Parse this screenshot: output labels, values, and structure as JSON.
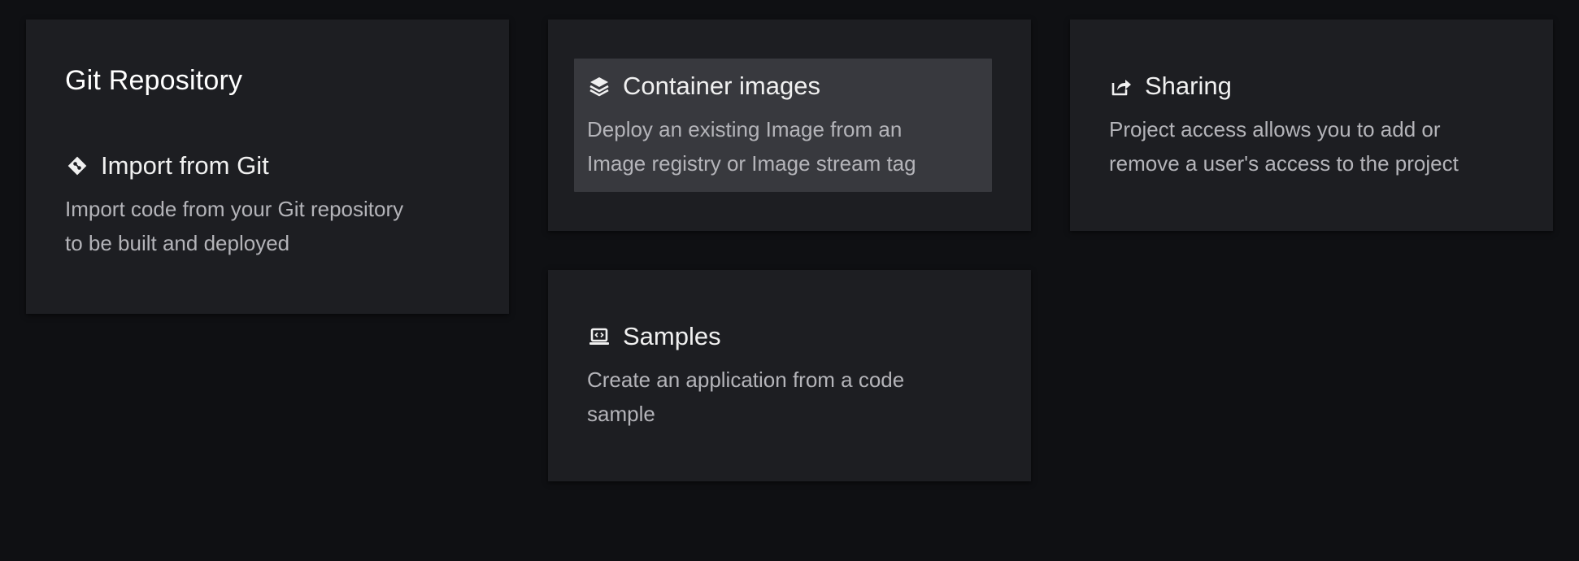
{
  "cards": {
    "git": {
      "title": "Git Repository",
      "item": {
        "icon": "git-icon",
        "title": "Import from Git",
        "desc_line1": "Import code from your Git repository",
        "desc_line2": "to be built and deployed"
      }
    },
    "container": {
      "item": {
        "icon": "layers-icon",
        "title": "Container images",
        "desc_line1": "Deploy an existing Image from an",
        "desc_line2": "Image registry or Image stream tag"
      }
    },
    "sharing": {
      "item": {
        "icon": "share-icon",
        "title": "Sharing",
        "desc_line1": "Project access allows you to add or",
        "desc_line2": "remove a user's access to the project"
      }
    },
    "samples": {
      "item": {
        "icon": "laptop-code-icon",
        "title": "Samples",
        "desc_line1": "Create an application from a code",
        "desc_line2": "sample"
      }
    }
  }
}
